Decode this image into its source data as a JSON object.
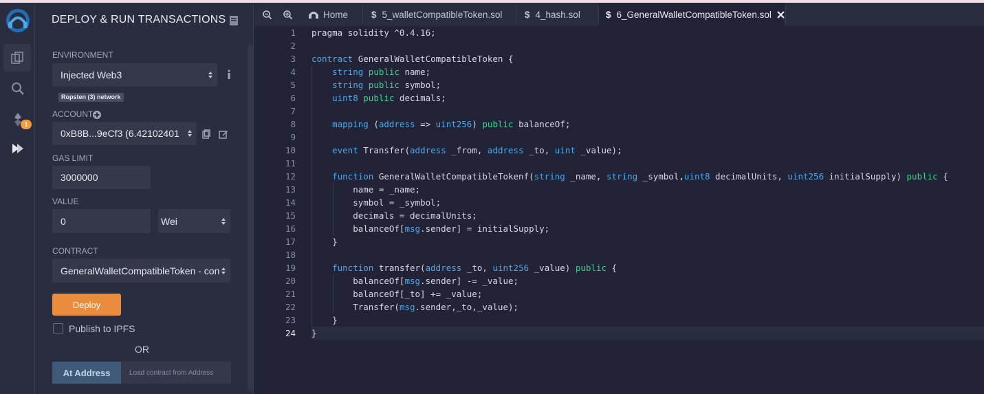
{
  "panel": {
    "title": "DEPLOY & RUN TRANSACTIONS",
    "environment_label": "ENVIRONMENT",
    "environment_value": "Injected Web3",
    "network_badge": "Ropsten (3) network",
    "account_label": "ACCOUNT",
    "account_value": "0xB8B...9eCf3 (6.42102401",
    "gas_limit_label": "GAS LIMIT",
    "gas_limit_value": "3000000",
    "value_label": "VALUE",
    "value_value": "0",
    "value_unit": "Wei",
    "contract_label": "CONTRACT",
    "contract_value": "GeneralWalletCompatibleToken - con",
    "deploy_label": "Deploy",
    "publish_label": "Publish to IPFS",
    "or_label": "OR",
    "at_address_label": "At Address",
    "load_address_placeholder": "Load contract from Address"
  },
  "iconbar": {
    "plugin_badge": "1"
  },
  "tabs": [
    {
      "label": "Home"
    },
    {
      "label": "5_walletCompatibleToken.sol"
    },
    {
      "label": "4_hash.sol"
    },
    {
      "label": "6_GeneralWalletCompatibleToken.sol"
    }
  ],
  "editor": {
    "current_line": 24,
    "lines": [
      "1",
      "2",
      "3",
      "4",
      "5",
      "6",
      "7",
      "8",
      "9",
      "10",
      "11",
      "12",
      "13",
      "14",
      "15",
      "16",
      "17",
      "18",
      "19",
      "20",
      "21",
      "22",
      "23",
      "24"
    ]
  },
  "colors": {
    "accent": "#e98c3d",
    "keyword": "#4ea8e6",
    "keyword_green": "#3fcf8e",
    "background": "#222336",
    "panel": "#2a2c3f"
  }
}
